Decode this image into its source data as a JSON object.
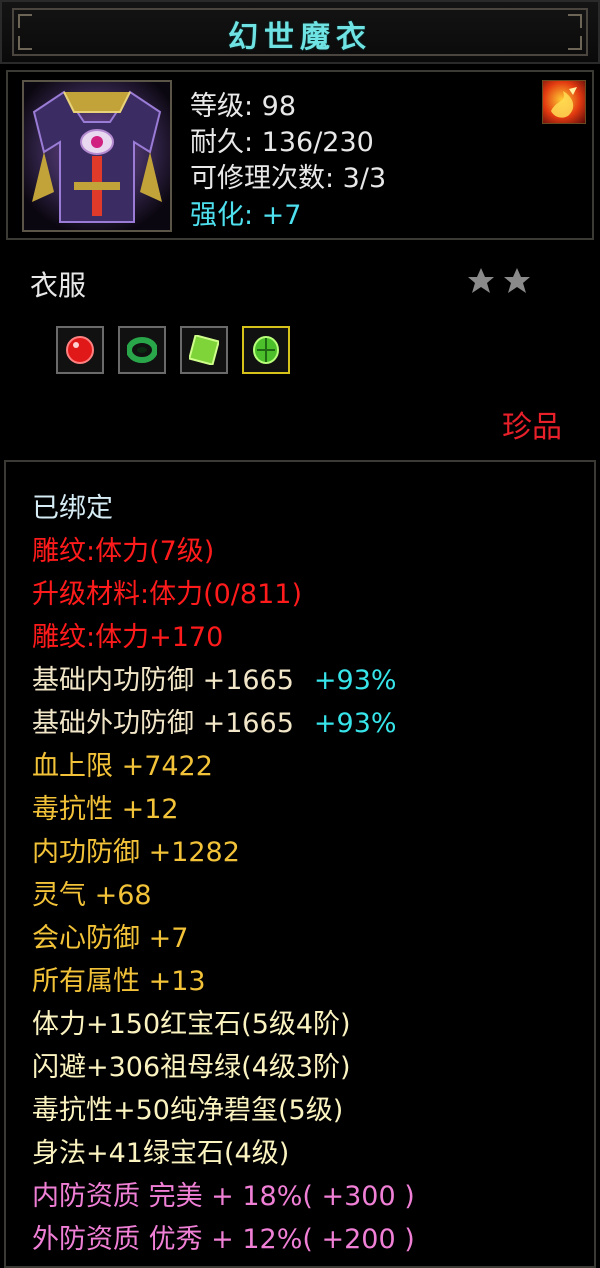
{
  "title": "幻世魔衣",
  "info": {
    "level": "等级: 98",
    "durability": "耐久: 136/230",
    "repair": "可修理次数: 3/3",
    "enhance": "强化: +7"
  },
  "icons": {
    "item": "armor-robe-icon",
    "skill": "fire-skill-icon",
    "star": "star-icon"
  },
  "type_label": "衣服",
  "stars": 2,
  "gems": [
    {
      "name": "ruby-gem-icon",
      "color": "#e01818"
    },
    {
      "name": "jade-ring-gem-icon",
      "color": "#2aa64a"
    },
    {
      "name": "green-crystal-gem-icon",
      "color": "#7fd43a"
    },
    {
      "name": "emerald-gem-icon",
      "color": "#4cc02a"
    }
  ],
  "rarity": "珍品",
  "attributes": {
    "bound": "已绑定",
    "engrave_level": "雕纹:体力(7级)",
    "upgrade_material": "升级材料:体力(0/811)",
    "engrave_bonus": "雕纹:体力+170",
    "base_inner_def": "基础内功防御  +1665",
    "base_inner_def_pct": "+93%",
    "base_outer_def": "基础外功防御  +1665",
    "base_outer_def_pct": "+93%",
    "hp_max": "血上限  +7422",
    "poison_res": "毒抗性  +12",
    "inner_def": "内功防御  +1282",
    "spirit": "灵气  +68",
    "crit_def": "会心防御  +7",
    "all_stats": "所有属性  +13",
    "socket_1": "体力+150红宝石(5级4阶)",
    "socket_2": "闪避+306祖母绿(4级3阶)",
    "socket_3": "毒抗性+50纯净碧玺(5级)",
    "socket_4": "身法+41绿宝石(4级)",
    "quality_inner": "内防资质  完美  + 18%(  +300  )",
    "quality_outer": "外防资质  优秀  + 12%(  +200  )"
  }
}
